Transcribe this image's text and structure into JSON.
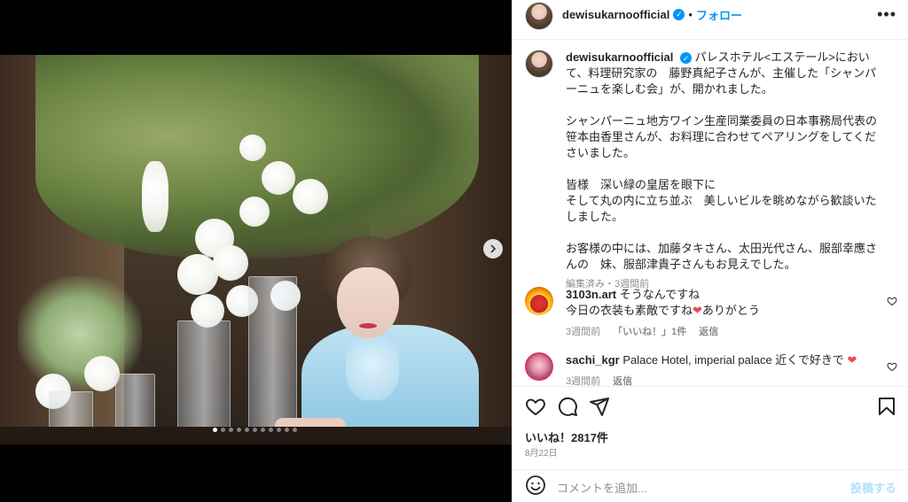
{
  "post": {
    "username": "dewisukarnoofficial",
    "follow_label": "フォロー",
    "more_label": "•••",
    "separator": "•"
  },
  "caption": {
    "username": "dewisukarnoofficial",
    "text_1": "パレスホテル<エステール>において、料理研究家の　藤野真紀子さんが、主催した「シャンパーニュを楽しむ会」が、開かれました。",
    "text_2": "シャンパーニュ地方ワイン生産同業委員の日本事務局代表の笹本由香里さんが、お料理に合わせてペアリングをしてくださいました。",
    "text_3": "皆様　深い緑の皇居を眼下に\nそして丸の内に立ち並ぶ　美しいビルを眺めながら歓談いたしました。",
    "text_4": "お客様の中には、加藤タキさん、太田光代さん、服部幸應さんの　妹、服部津貴子さんもお見えでした。",
    "meta": "編集済み・3週間前"
  },
  "comments": [
    {
      "username": "3103n.art",
      "text": "そうなんですね\n今日の衣装も素敵ですね",
      "emoji": "❤",
      "suffix": "ありがとう",
      "time": "3週間前",
      "likes": "「いいね！」1件",
      "reply": "返信"
    },
    {
      "username": "sachi_kgr",
      "text": "Palace Hotel, imperial palace 近くで好きで",
      "emoji": "❤",
      "time": "3週間前",
      "reply": "返信"
    }
  ],
  "likes": "いいね！2817件",
  "date": "8月22日",
  "add_comment": {
    "placeholder": "コメントを追加...",
    "post_label": "投稿する"
  },
  "icons": {
    "verified": "verified-badge-icon",
    "next": "chevron-right-icon",
    "like": "heart-icon",
    "comment": "comment-bubble-icon",
    "share": "paper-plane-icon",
    "save": "bookmark-icon",
    "emoji": "smiley-icon"
  },
  "carousel": {
    "count": 11,
    "active": 0
  },
  "colors": {
    "accent": "#0095f6",
    "muted": "#8e8e8e",
    "heart": "#ed4956"
  }
}
